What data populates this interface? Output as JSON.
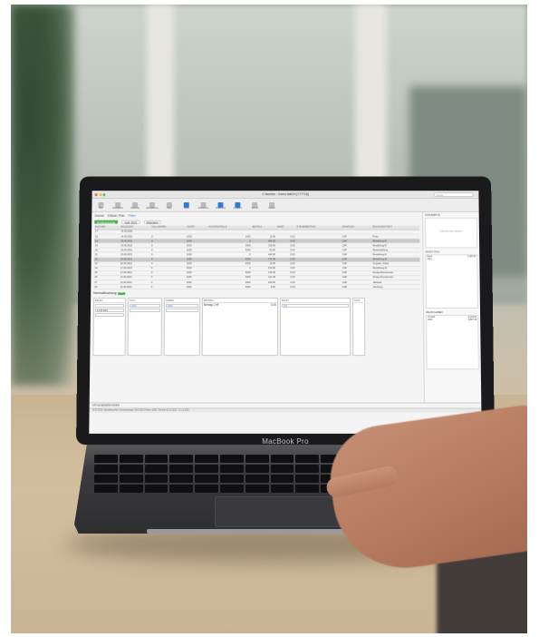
{
  "laptop": {
    "brand": "MacBook Pro"
  },
  "app": {
    "window_title": "C Buchen - Demo AdDr0 [777713]",
    "search_placeholder": "Suche",
    "toolbar": [
      {
        "label": "Neu",
        "icon": "new-icon"
      },
      {
        "label": "Duplizieren",
        "icon": "duplicate-icon"
      },
      {
        "label": "Buchung",
        "icon": "add-icon"
      },
      {
        "label": "Aktualisieren",
        "icon": "refresh-icon"
      },
      {
        "label": "Filter",
        "icon": "filter-icon"
      },
      {
        "label": "Inbox",
        "icon": "inbox-icon"
      },
      {
        "label": "Abstimmen",
        "icon": "reconcile-icon"
      },
      {
        "label": "Belastung",
        "icon": "debit-icon"
      },
      {
        "label": "Ausgabe",
        "icon": "output-icon"
      },
      {
        "label": "Schnitt",
        "icon": "cut-icon"
      },
      {
        "label": "Finden",
        "icon": "find-icon"
      }
    ],
    "filter": {
      "journal": "Journal",
      "active_pill": "Kontoauszüge",
      "period": "Jahr 2021",
      "buchungen": "Erfasst / Plan",
      "mode": "Filtern",
      "view": "Standard"
    },
    "table": {
      "headers": [
        "BUCHNR",
        "BELEGDAT",
        "VOLLNAMEN",
        "KONTO",
        "KOSTENSTELLE",
        "BETRAG",
        "MWST",
        "STEUERBETRAG",
        "WÄHRUNG",
        "BUCHUNGSTEXT"
      ],
      "rows": [
        [
          "17",
          "14.06.2021",
          "",
          "",
          "",
          "",
          "",
          "",
          "",
          ""
        ],
        [
          "18",
          "14.06.2021",
          "0",
          "1020",
          "1000",
          "10.00",
          "0.00",
          "",
          "CHF",
          "Porto"
        ],
        [
          "19",
          "14.06.2021",
          "0",
          "1020",
          "0",
          "400.00",
          "0.00",
          "",
          "CHF",
          "Bezahlung M"
        ],
        [
          "19",
          "15.06.2021",
          "0",
          "1020",
          "3200",
          "315.60",
          "0.00",
          "",
          "CHF",
          "Bezahlung M"
        ],
        [
          "20",
          "15.06.2021",
          "0",
          "1020",
          "3200",
          "52.00",
          "0.00",
          "",
          "CHF",
          "Bareinzahlung"
        ],
        [
          "21",
          "15.06.2021",
          "0",
          "1020",
          "0",
          "440.00",
          "0.00",
          "",
          "CHF",
          "Bezahlung M"
        ],
        [
          "22",
          "15.06.2021",
          "0",
          "1020",
          "3200",
          "376.50",
          "0.00",
          "",
          "CHF",
          "Bezahlung M"
        ],
        [
          "23",
          "16.06.2021",
          "0",
          "1020",
          "3200",
          "10.00",
          "0.00",
          "",
          "CHF",
          "Kopierer, Kiosk"
        ],
        [
          "24",
          "17.06.2021",
          "0",
          "1020",
          "0",
          "150.00",
          "0.00",
          "",
          "CHF",
          "Bezahlung M"
        ],
        [
          "25",
          "17.06.2021",
          "0",
          "1020",
          "3200",
          "134.50",
          "0.00",
          "",
          "CHF",
          "Ertrag Abonnement"
        ],
        [
          "26",
          "21.06.2021",
          "0",
          "1020",
          "3200",
          "212.45",
          "0.00",
          "",
          "CHF",
          "Ertrag Abonnement"
        ],
        [
          "27",
          "21.06.2021",
          "0",
          "1020",
          "3200",
          "430.00",
          "0.00",
          "",
          "CHF",
          "Material"
        ],
        [
          "28",
          "21.06.2021",
          "0",
          "1020",
          "3200",
          "9.00",
          "0.00",
          "",
          "CHF",
          "Werbung"
        ]
      ]
    },
    "booking": {
      "title": "Normalbuchung",
      "badge": "Neu",
      "beleg_label": "BELEG",
      "datum": "14.06.2021",
      "betrag_label": "BETRAG",
      "betrag_chf": "Betrag CHF",
      "betrag_value": "0.00",
      "soll_label": "SOLL",
      "soll_konto": "1020",
      "haben_label": "HABEN",
      "haben_konto": "3200",
      "mwst_label": "MWST",
      "mwst_code": "311",
      "kst_label": "KOSTENSTELLE",
      "text_label": "TEXT",
      "datum_label": "DATUM BEMERKUNGEN"
    },
    "sidebar": {
      "docs_title": "DOKUMENTE",
      "docs_sub": "Dokument hier ablegen",
      "saldo_soll": "SALDO SOLL",
      "saldo_soll_konto": "Bank",
      "saldo_soll_year": "2021",
      "saldo_soll_value": "2,380.00",
      "saldo_haben": "SALDO HABEN",
      "saldo_haben_konto": "Umsatz",
      "saldo_haben_year": "2021",
      "saldo_haben_value": "2,120.00",
      "saldo_haben_value2": "4,897.18"
    },
    "status_bar": "13.07.2021 | Bezahlung Alle | Kontoauszüge | Soll 1020 | Haben 3200 | Periode 01.01.2021 - 31.12.2021"
  }
}
